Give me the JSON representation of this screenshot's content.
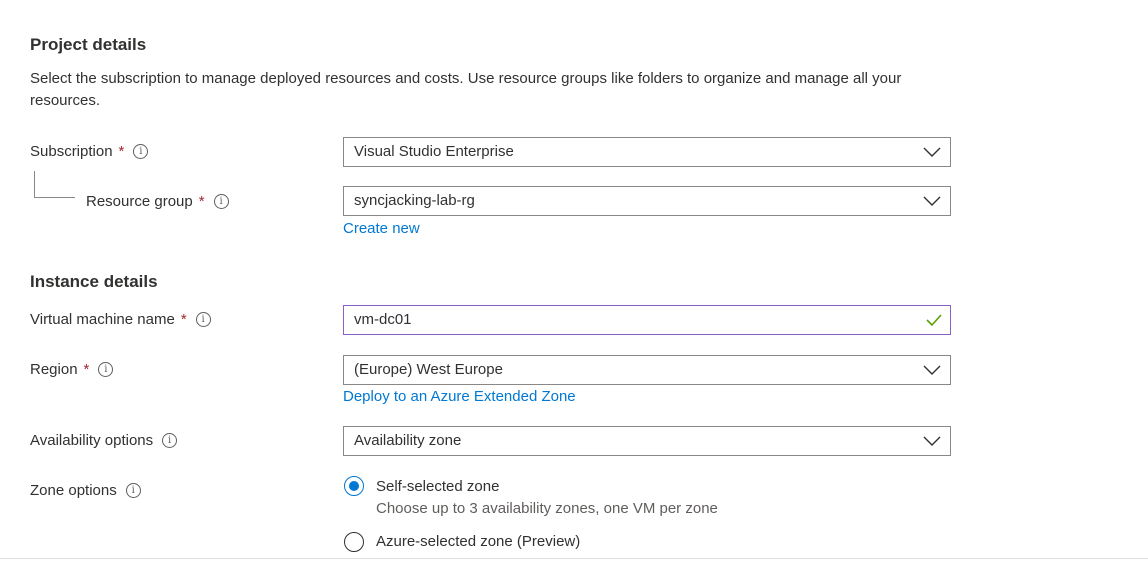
{
  "project": {
    "heading": "Project details",
    "description": "Select the subscription to manage deployed resources and costs. Use resource groups like folders to organize and manage all your resources.",
    "subscription_label": "Subscription",
    "subscription_value": "Visual Studio Enterprise",
    "resource_group_label": "Resource group",
    "resource_group_value": "syncjacking-lab-rg",
    "create_new": "Create new"
  },
  "instance": {
    "heading": "Instance details",
    "vm_name_label": "Virtual machine name",
    "vm_name_value": "vm-dc01",
    "region_label": "Region",
    "region_value": "(Europe) West Europe",
    "extended_zone_link": "Deploy to an Azure Extended Zone",
    "availability_label": "Availability options",
    "availability_value": "Availability zone",
    "zone_options_label": "Zone options",
    "zone_options": [
      {
        "label": "Self-selected zone",
        "sublabel": "Choose up to 3 availability zones, one VM per zone",
        "selected": true
      },
      {
        "label": "Azure-selected zone (Preview)",
        "selected": false
      }
    ]
  },
  "common": {
    "required_mark": "*",
    "info_glyph": "i"
  },
  "colors": {
    "accent": "#0078d4",
    "required": "#a4262c",
    "valid": "#57a300",
    "valid_border": "#8a61c9"
  },
  "icons": {
    "dropdown": "chevron-down-icon",
    "info": "info-icon",
    "valid": "checkmark-icon"
  }
}
